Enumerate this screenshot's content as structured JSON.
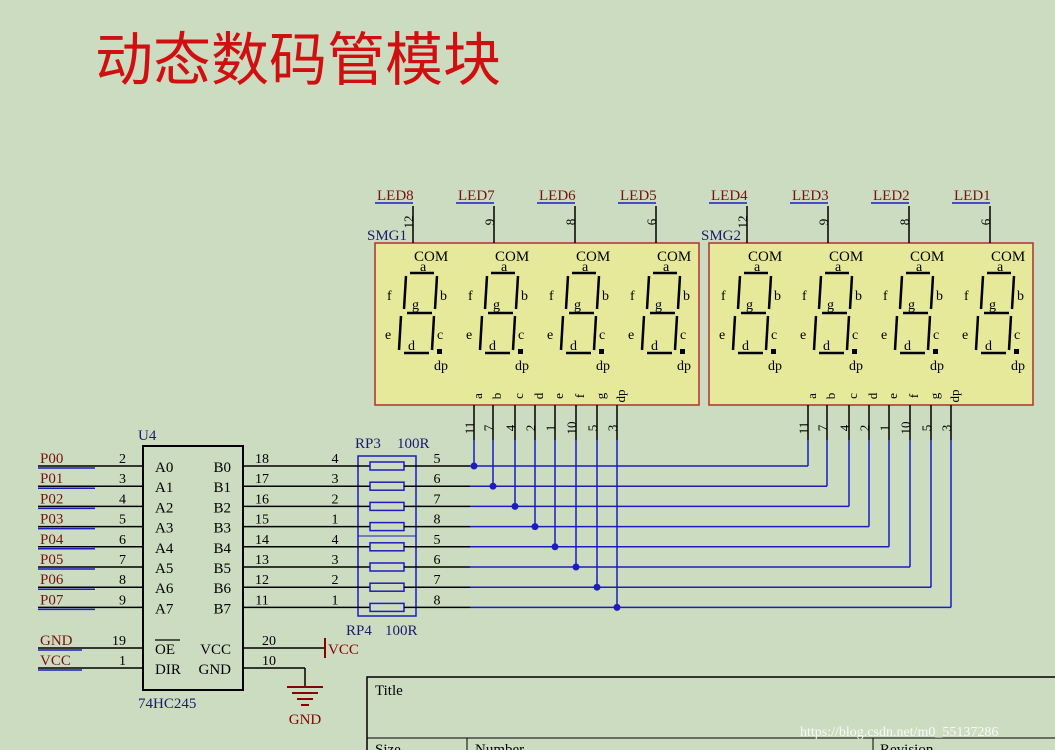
{
  "title": "动态数码管模块",
  "watermark": "https://blog.csdn.net/m0_55137286",
  "colors": {
    "background": "#ccdcc0",
    "title": "#d01010",
    "wire": "#1d1dbf",
    "net_label": "#7a1010",
    "pin_number": "#800000",
    "display_fill": "#e6e89a",
    "display_border": "#b03030",
    "text": "#000000"
  },
  "chip": {
    "designator": "U4",
    "part": "74HC245",
    "left_pins": [
      {
        "net": "P00",
        "num": "2",
        "name": "A0"
      },
      {
        "net": "P01",
        "num": "3",
        "name": "A1"
      },
      {
        "net": "P02",
        "num": "4",
        "name": "A2"
      },
      {
        "net": "P03",
        "num": "5",
        "name": "A3"
      },
      {
        "net": "P04",
        "num": "6",
        "name": "A4"
      },
      {
        "net": "P05",
        "num": "7",
        "name": "A5"
      },
      {
        "net": "P06",
        "num": "8",
        "name": "A6"
      },
      {
        "net": "P07",
        "num": "9",
        "name": "A7"
      }
    ],
    "right_pins": [
      {
        "num": "18",
        "name": "B0"
      },
      {
        "num": "17",
        "name": "B1"
      },
      {
        "num": "16",
        "name": "B2"
      },
      {
        "num": "15",
        "name": "B3"
      },
      {
        "num": "14",
        "name": "B4"
      },
      {
        "num": "13",
        "name": "B5"
      },
      {
        "num": "12",
        "name": "B6"
      },
      {
        "num": "11",
        "name": "B7"
      }
    ],
    "ctrl_left": [
      {
        "net": "GND",
        "num": "19",
        "name": "OE"
      },
      {
        "net": "VCC",
        "num": "1",
        "name": "DIR"
      }
    ],
    "ctrl_right": [
      {
        "num": "20",
        "name": "VCC",
        "net": "VCC"
      },
      {
        "num": "10",
        "name": "GND",
        "net": "GND"
      }
    ]
  },
  "resistor_packs": [
    {
      "designator": "RP3",
      "value": "100R",
      "left_pins": [
        "4",
        "3",
        "2",
        "1"
      ],
      "right_pins": [
        "5",
        "6",
        "7",
        "8"
      ]
    },
    {
      "designator": "RP4",
      "value": "100R",
      "left_pins": [
        "4",
        "3",
        "2",
        "1"
      ],
      "right_pins": [
        "5",
        "6",
        "7",
        "8"
      ]
    }
  ],
  "displays": [
    {
      "designator": "SMG1",
      "com_leds": [
        "LED8",
        "LED7",
        "LED6",
        "LED5"
      ],
      "com_pins": [
        "12",
        "9",
        "8",
        "6"
      ]
    },
    {
      "designator": "SMG2",
      "com_leds": [
        "LED4",
        "LED3",
        "LED2",
        "LED1"
      ],
      "com_pins": [
        "12",
        "9",
        "8",
        "6"
      ]
    }
  ],
  "segment_pins": [
    {
      "seg": "a",
      "num": "11"
    },
    {
      "seg": "b",
      "num": "7"
    },
    {
      "seg": "c",
      "num": "4"
    },
    {
      "seg": "d",
      "num": "2"
    },
    {
      "seg": "e",
      "num": "1"
    },
    {
      "seg": "f",
      "num": "10"
    },
    {
      "seg": "g",
      "num": "5"
    },
    {
      "seg": "dp",
      "num": "3"
    }
  ],
  "digit_labels": {
    "com": "COM",
    "a": "a",
    "b": "b",
    "c": "c",
    "d": "d",
    "e": "e",
    "f": "f",
    "g": "g",
    "dp": "dp"
  },
  "title_block": {
    "title": "Title",
    "size": "Size",
    "number": "Number",
    "revision": "Revision"
  }
}
